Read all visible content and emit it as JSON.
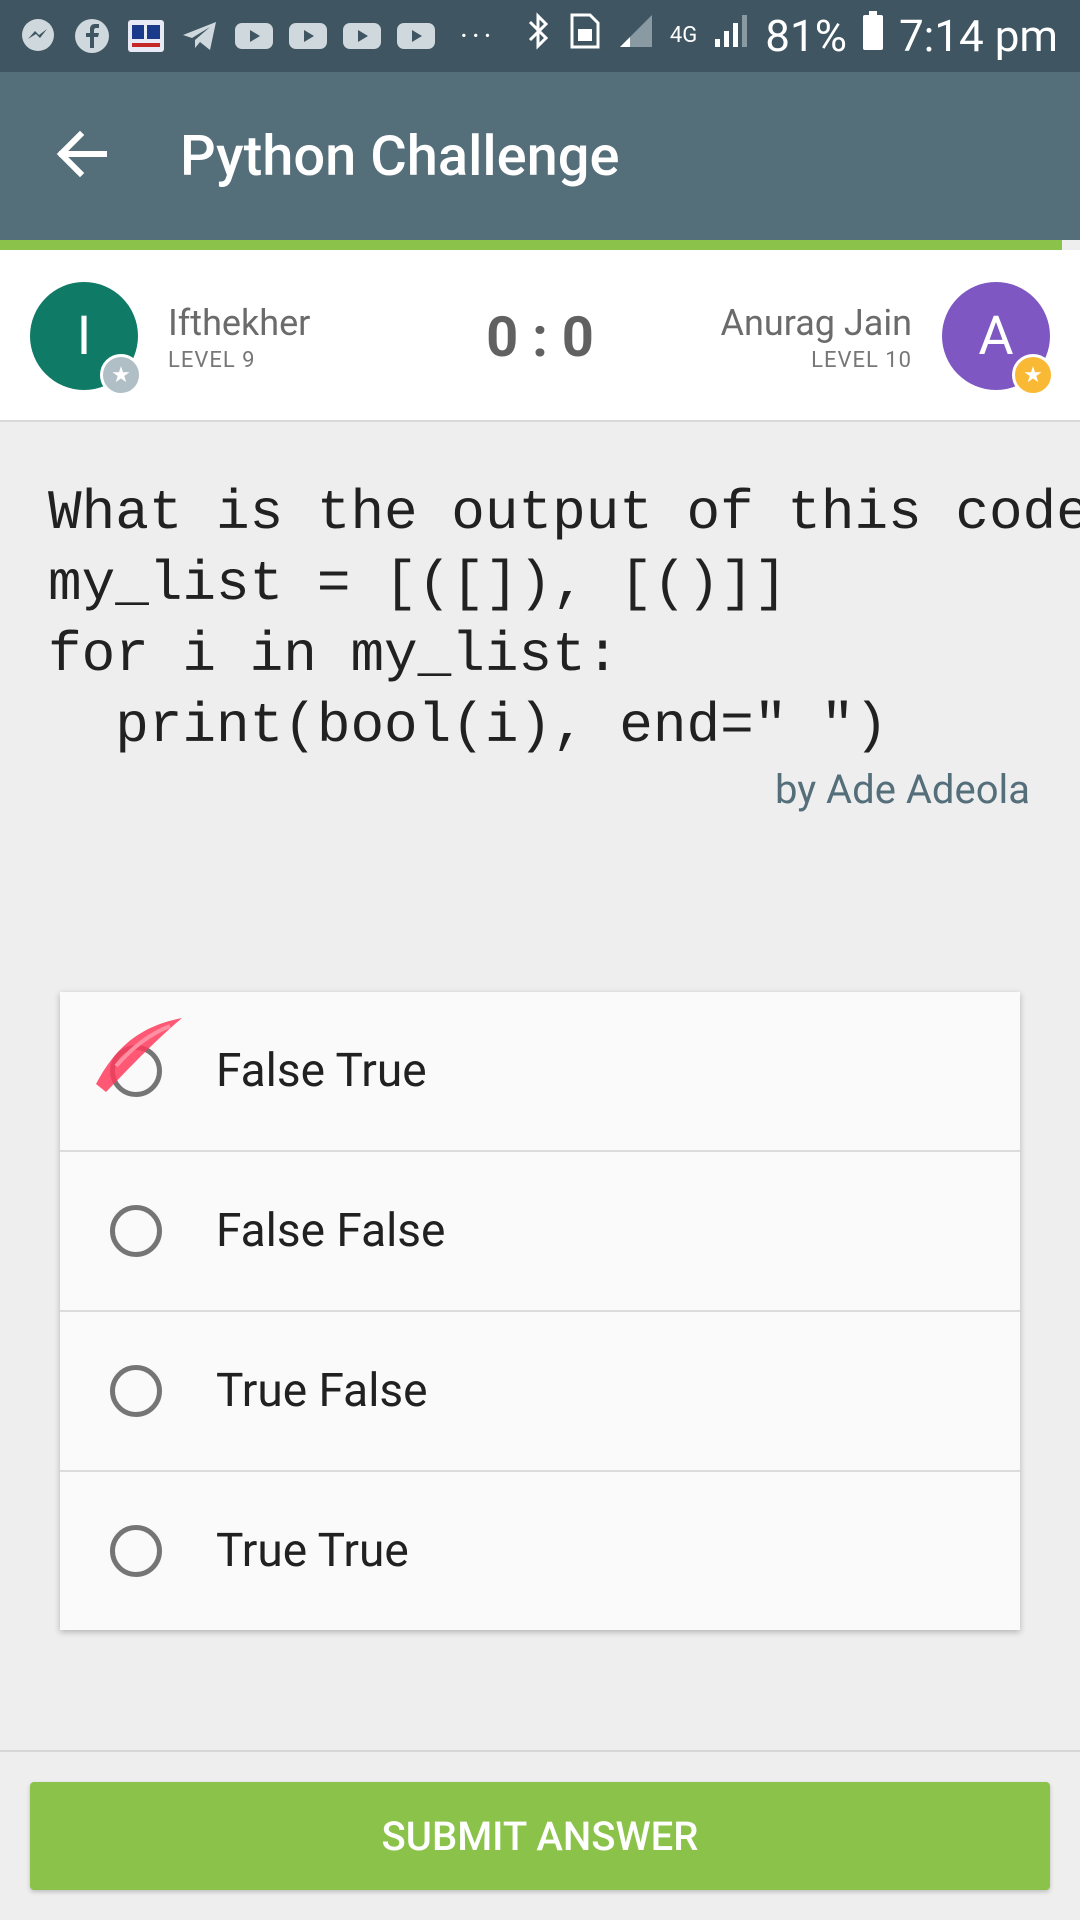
{
  "status_bar": {
    "battery": "81%",
    "time": "7:14 pm",
    "network": "4G",
    "notification_icons": [
      "messenger-icon",
      "facebook-icon",
      "news-app-icon",
      "telegram-icon",
      "youtube-icon",
      "youtube-icon",
      "youtube-icon",
      "youtube-icon"
    ],
    "more": "···"
  },
  "app_bar": {
    "title": "Python Challenge"
  },
  "players": {
    "left": {
      "initial": "I",
      "name": "Ifthekher",
      "level": "LEVEL 9",
      "color": "#0f7a65"
    },
    "right": {
      "initial": "A",
      "name": "Anurag Jain",
      "level": "LEVEL 10",
      "color": "#7e57c2"
    },
    "score": "0 : 0"
  },
  "question": {
    "text": "What is the output of this code?\nmy_list = [([]), [()]]\nfor i in my_list:\n  print(bool(i), end=\" \")",
    "author": "by Ade Adeola"
  },
  "options": [
    {
      "label": "False True"
    },
    {
      "label": "False False"
    },
    {
      "label": "True False"
    },
    {
      "label": "True True"
    }
  ],
  "submit_label": "SUBMIT ANSWER",
  "colors": {
    "accent": "#8bc34a",
    "appbar": "#546e7a",
    "statusbar": "#3f5662"
  }
}
